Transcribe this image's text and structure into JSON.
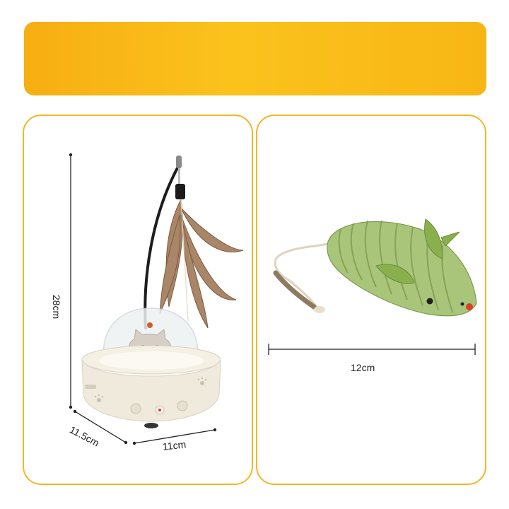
{
  "left_panel": {
    "height_label": "28cm",
    "depth_label": "11.5cm",
    "width_label": "11cm",
    "product_icon": "ufo-cat-feather-teaser-icon"
  },
  "right_panel": {
    "length_label": "12cm",
    "product_icon": "sisal-mouse-toy-icon"
  },
  "colors": {
    "banner": "#f9b81a",
    "card_border": "#f5b52a",
    "mouse_green": "#9ec06a",
    "toy_base": "#efeadc"
  }
}
